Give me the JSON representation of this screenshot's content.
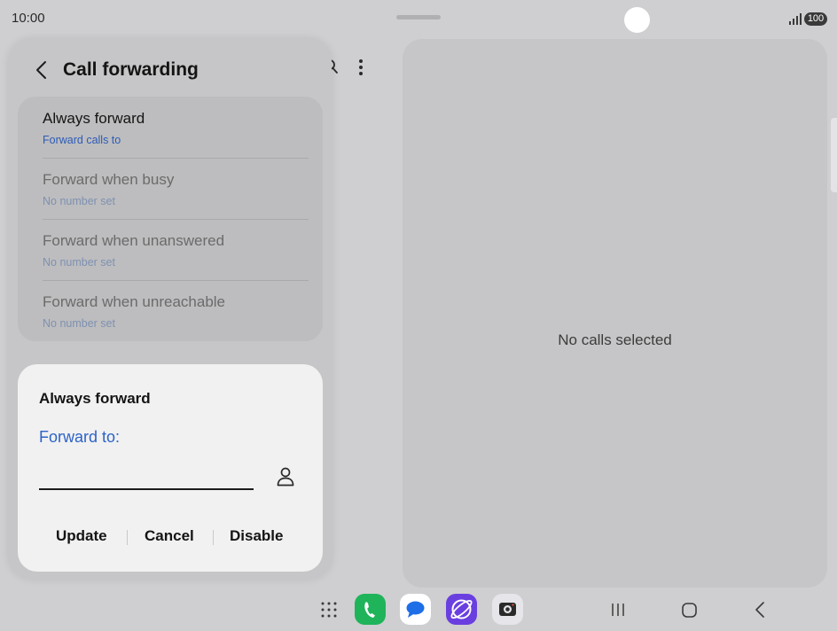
{
  "status_bar": {
    "time": "10:00",
    "battery": "100"
  },
  "popup": {
    "title": "Call forwarding",
    "items": [
      {
        "label": "Always forward",
        "sub": "Forward calls to"
      },
      {
        "label": "Forward when busy",
        "sub": "No number set"
      },
      {
        "label": "Forward when unanswered",
        "sub": "No number set"
      },
      {
        "label": "Forward when unreachable",
        "sub": "No number set"
      }
    ]
  },
  "dialog": {
    "title": "Always forward",
    "field_label": "Forward to:",
    "input_value": "",
    "buttons": {
      "update": "Update",
      "cancel": "Cancel",
      "disable": "Disable"
    }
  },
  "detail": {
    "empty_text": "No calls selected"
  },
  "dock": [
    "phone-icon",
    "messages-icon",
    "internet-icon",
    "camera-icon"
  ],
  "colors": {
    "accent": "#2d63c8",
    "link": "#2d5bb5",
    "phone_app": "#1fb45a",
    "browser_app": "#6a3fe0"
  }
}
